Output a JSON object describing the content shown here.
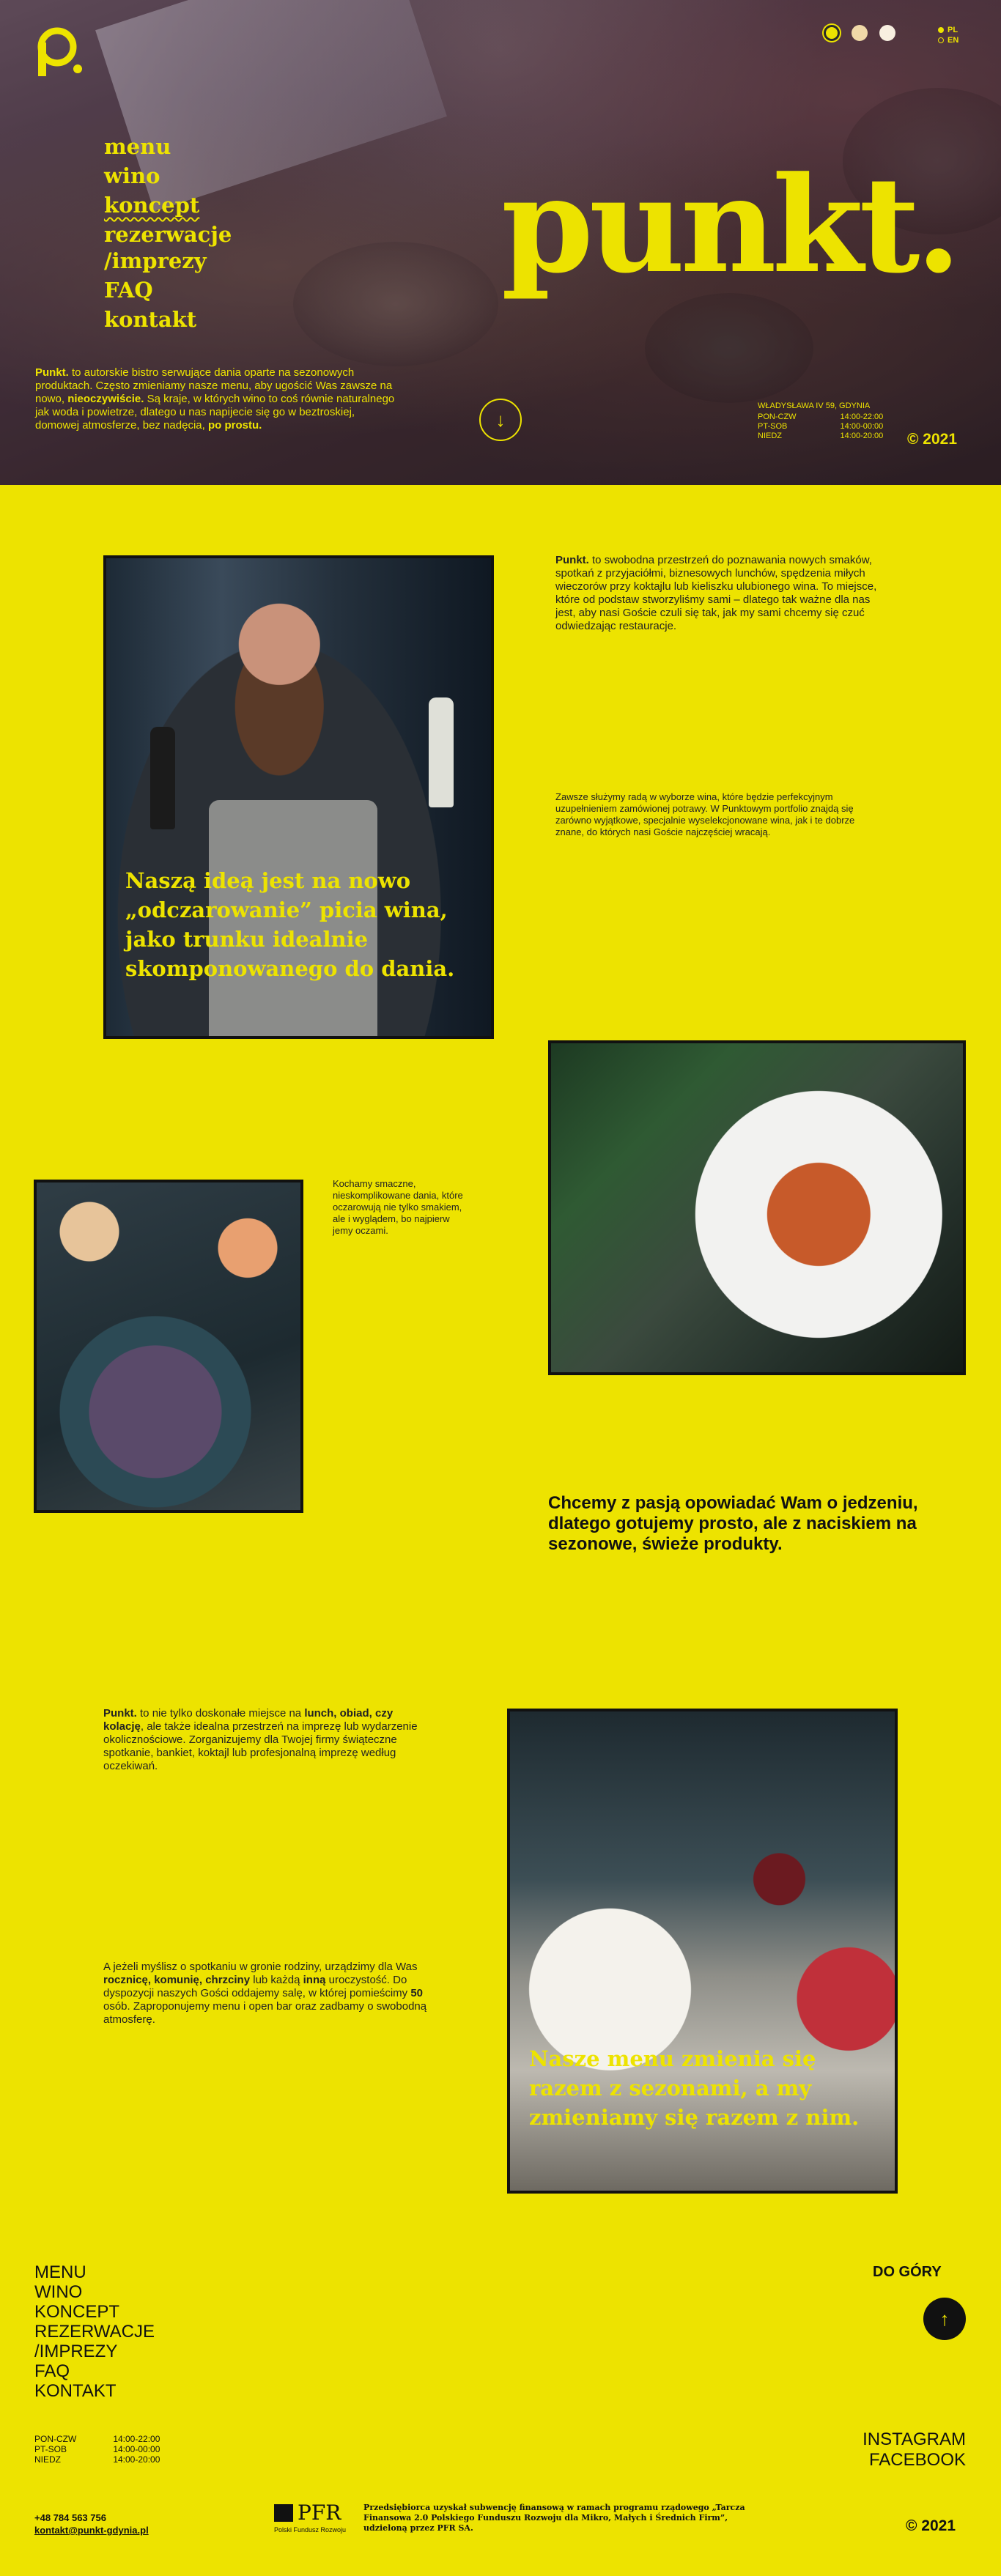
{
  "hero": {
    "nav": [
      "menu",
      "wino",
      "koncept",
      "rezerwacje",
      "/imprezy",
      "FAQ",
      "kontakt"
    ],
    "about_brand": "Punkt.",
    "about_1": " to autorskie bistro serwujące dania oparte na sezonowych produktach. Często zmieniamy nasze menu, aby ugościć Was zawsze na nowo, ",
    "about_bold": "nieoczywiście.",
    "about_2": " Są kraje, w których wino to coś równie naturalnego jak woda i powietrze, dlatego u nas napijecie się go w beztroskiej, domowej atmosferze, bez nadęcia, ",
    "about_end": "po prostu.",
    "brand": "punkt.",
    "lang": [
      "PL",
      "EN"
    ],
    "address": "WŁADYSŁAWA IV 59, GDYNIA",
    "hours": [
      {
        "days": "PON-CZW",
        "time": "14:00-22:00"
      },
      {
        "days": "PT-SOB",
        "time": "14:00-00:00"
      },
      {
        "days": "NIEDZ",
        "time": "14:00-20:00"
      }
    ],
    "copyright": "© 2021",
    "colors": [
      "#ede300",
      "#f0d9a8",
      "#f8efe0"
    ]
  },
  "section1": {
    "quote": "Naszą ideą jest na nowo „odczarowanie” picia wina, jako trunku idealnie skomponowanego do dania.",
    "text1_brand": "Punkt.",
    "text1": " to swobodna przestrzeń do poznawania nowych smaków, spotkań z przyjaciółmi, biznesowych lunchów, spędzenia miłych wieczorów przy koktajlu lub kieliszku ulubionego wina. To miejsce, które od podstaw stworzyliśmy sami – dlatego tak ważne dla nas jest, aby nasi Goście czuli się tak, jak my sami chcemy się czuć odwiedzając restauracje.",
    "text2": "Zawsze służymy radą w wyborze wina, które będzie perfekcyjnym uzupełnieniem zamówionej potrawy. W Punktowym portfolio znajdą się zarówno wyjątkowe, specjalnie wyselekcjonowane wina, jak i te dobrze znane, do których nasi Goście najczęściej wracają."
  },
  "section2": {
    "text": "Kochamy smaczne, nieskomplikowane dania, które oczarowują nie tylko smakiem, ale i wyglądem, bo najpierw jemy oczami.",
    "headline": "Chcemy z pasją opowiadać Wam o jedzeniu, dlatego gotujemy prosto, ale z naciskiem na sezonowe, świeże produkty."
  },
  "section3": {
    "p1_brand": "Punkt.",
    "p1_a": " to nie tylko doskonałe miejsce na ",
    "p1_b": "lunch, obiad, czy kolację",
    "p1_c": ", ale także idealna przestrzeń na imprezę lub wydarzenie okolicznościowe. Zorganizujemy dla Twojej firmy świąteczne spotkanie, bankiet, koktajl lub profesjonalną imprezę według oczekiwań.",
    "p2_a": "A jeżeli myślisz o spotkaniu w gronie rodziny, urządzimy dla Was ",
    "p2_b": "rocznicę, komunię, chrzciny",
    "p2_c": " lub każdą ",
    "p2_d": "inną",
    "p2_e": " uroczystość. Do dyspozycji naszych Gości oddajemy salę, w której pomieścimy ",
    "p2_f": "50",
    "p2_g": " osób. Zaproponujemy menu i open bar oraz zadbamy o swobodną atmosferę.",
    "quote": "Nasze menu zmienia się razem z sezonami, a my zmieniamy się razem z nim."
  },
  "footer": {
    "nav": [
      "MENU",
      "WINO",
      "KONCEPT",
      "REZERWACJE",
      "/IMPREZY",
      "FAQ",
      "KONTAKT"
    ],
    "to_top": "DO GÓRY",
    "hours": [
      {
        "days": "PON-CZW",
        "time": "14:00-22:00"
      },
      {
        "days": "PT-SOB",
        "time": "14:00-00:00"
      },
      {
        "days": "NIEDZ",
        "time": "14:00-20:00"
      }
    ],
    "social": [
      "INSTAGRAM",
      "FACEBOOK"
    ],
    "phone": "+48 784 563 756",
    "email": "kontakt@punkt-gdynia.pl",
    "pfr_name": "PFR",
    "pfr_sub": "Polski Fundusz Rozwoju",
    "pfr_text": "Przedsiębiorca uzyskał subwencję finansową w ramach programu rządowego „Tarcza Finansowa 2.0 Polskiego Funduszu Rozwoju dla Mikro, Małych i Średnich Firm”, udzieloną przez PFR SA.",
    "copyright": "© 2021"
  }
}
